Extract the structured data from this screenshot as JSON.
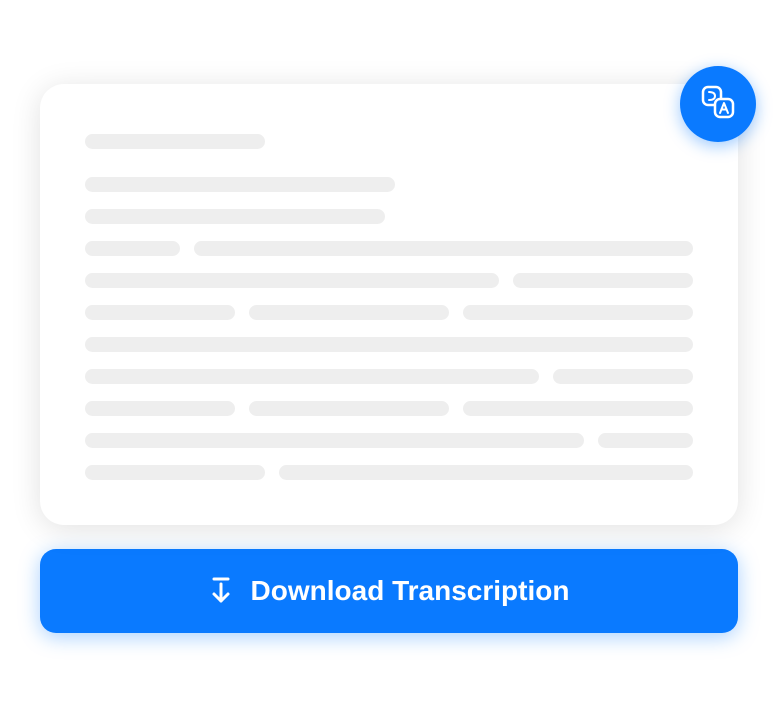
{
  "translate": {
    "icon_name": "translate-icon"
  },
  "download": {
    "label": "Download Transcription",
    "icon_name": "download-icon"
  },
  "colors": {
    "accent": "#0a7aff",
    "skeleton": "#eeeeee",
    "card_bg": "#ffffff"
  }
}
